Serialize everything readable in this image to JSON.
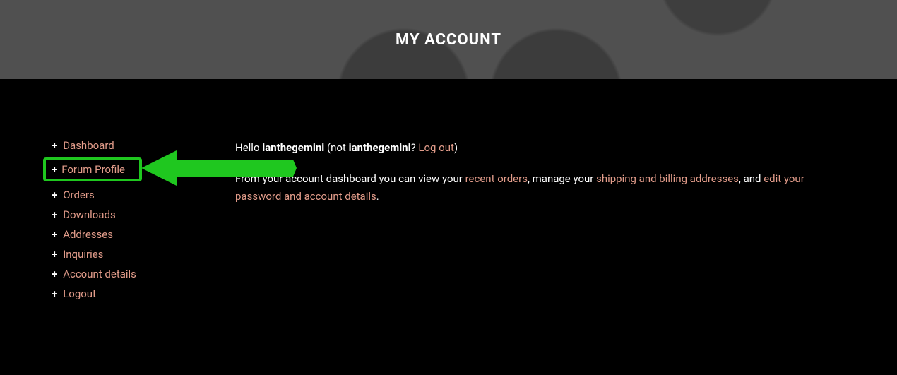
{
  "header": {
    "title": "MY ACCOUNT"
  },
  "nav": {
    "items": [
      {
        "label": "Dashboard"
      },
      {
        "label": "Forum Profile"
      },
      {
        "label": "Orders"
      },
      {
        "label": "Downloads"
      },
      {
        "label": "Addresses"
      },
      {
        "label": "Inquiries"
      },
      {
        "label": "Account details"
      },
      {
        "label": "Logout"
      }
    ]
  },
  "greeting": {
    "hello": "Hello ",
    "username": "ianthegemini",
    "not_open": " (not ",
    "username2": "ianthegemini",
    "not_close": "? ",
    "logout_label": "Log out",
    "end": ")"
  },
  "dash_text": {
    "part1": "From your account dashboard you can view your ",
    "link_orders": "recent orders",
    "part2": ", manage your ",
    "link_addresses": "shipping and billing addresses",
    "part3": ", and ",
    "link_edit": "edit your password and account details",
    "part4": "."
  }
}
